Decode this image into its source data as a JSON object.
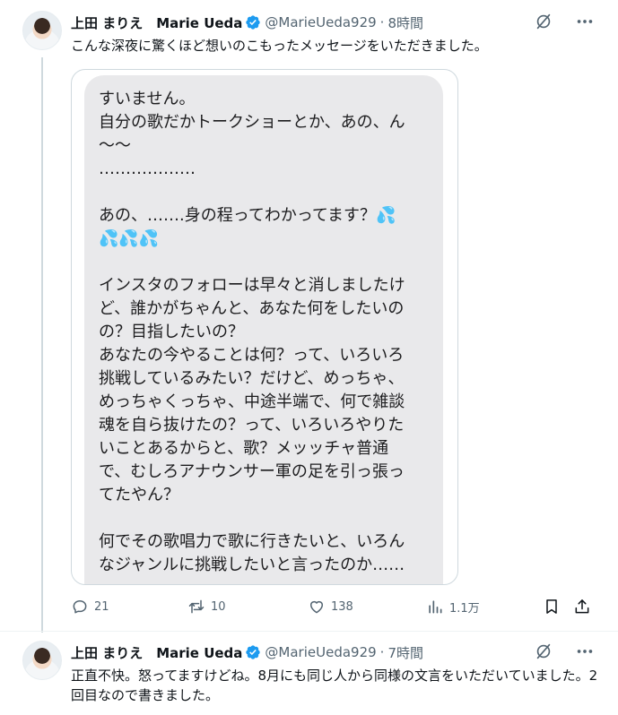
{
  "tweets": [
    {
      "display_name": "上田 まりえ　Marie Ueda",
      "handle": "@MarieUeda929",
      "separator": "·",
      "time": "8時間",
      "text": "こんな深夜に驚くほど想いのこもったメッセージをいただきました。",
      "image_lines": [
        "すいません。",
        "自分の歌だかトークショーとか、あの、ん",
        "〜〜",
        "………………",
        "",
        "あの、…….身の程ってわかってます？💦",
        "💦💦💦",
        "",
        "インスタのフォローは早々と消しましたけ",
        "ど、誰かがちゃんと、あなた何をしたいの",
        "の？目指したいの？",
        "あなたの今やることは何？って、いろいろ",
        "挑戦しているみたい？だけど、めっちゃ、",
        "めっちゃくっちゃ、中途半端で、何で雑談",
        "魂を自ら抜けたの？って、いろいろやりた",
        "いことあるからと、歌？メッッチャ普通",
        "で、むしろアナウンサー軍の足を引っ張っ",
        "てたやん？",
        "",
        "何でその歌唱力で歌に行きたいと、いろん",
        "なジャンルに挑戦したいと言ったのか……"
      ],
      "stats": {
        "replies": "21",
        "reposts": "10",
        "likes": "138",
        "views": "1.1万"
      }
    },
    {
      "display_name": "上田 まりえ　Marie Ueda",
      "handle": "@MarieUeda929",
      "separator": "·",
      "time": "7時間",
      "text": "正直不快。怒ってますけどね。8月にも同じ人から同様の文言をいただいていました。2回目なので書きました。"
    }
  ],
  "colors": {
    "verified": "#1d9bf0",
    "secondary_text": "#536471",
    "bubble": "#e9e9eb"
  },
  "icons": [
    "avatar",
    "verified-badge-icon",
    "grok-icon",
    "more-icon",
    "reply-icon",
    "repost-icon",
    "like-icon",
    "views-icon",
    "bookmark-icon",
    "share-icon"
  ]
}
